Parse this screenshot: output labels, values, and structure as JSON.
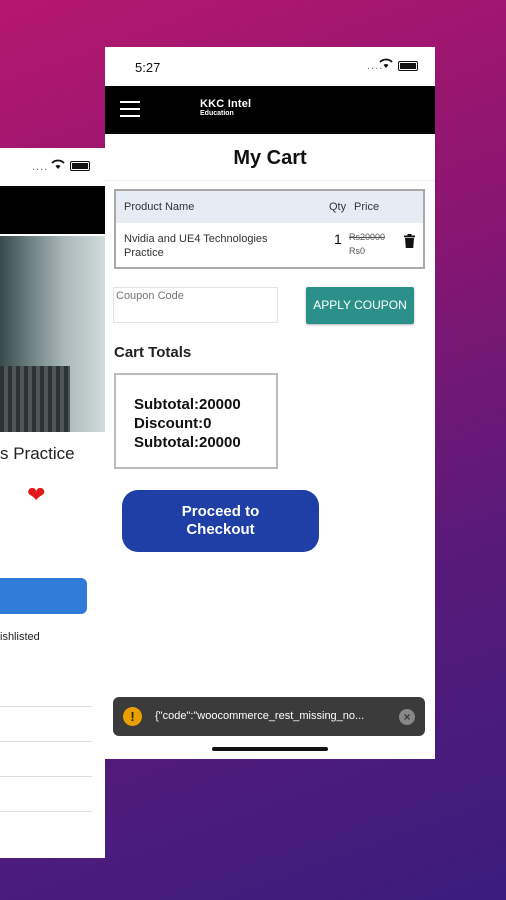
{
  "colors": {
    "accent_teal": "#2b8f8a",
    "checkout_blue": "#1f3fa6",
    "heart_red": "#e01a1a",
    "toast_bg": "#3b3b3b"
  },
  "back_screen": {
    "product_title": "s Practice",
    "wishlist_text": "ishlisted"
  },
  "status_bar": {
    "time": "5:27"
  },
  "app_bar": {
    "logo_line1": "KKC Intel",
    "logo_line2": "Education"
  },
  "page": {
    "title": "My Cart"
  },
  "cart_table": {
    "headers": {
      "product": "Product Name",
      "qty": "Qty",
      "price": "Price"
    },
    "rows": [
      {
        "name": "Nvidia and UE4 Technologies Practice",
        "qty": "1",
        "regular_price": "Rs20000",
        "sale_price": "Rs0"
      }
    ]
  },
  "coupon": {
    "placeholder": "Coupon Code",
    "apply_label": "APPLY COUPON"
  },
  "totals": {
    "heading": "Cart Totals",
    "line1": "Subtotal:20000",
    "line2": "Discount:0",
    "line3": "Subtotal:20000"
  },
  "checkout": {
    "label": "Proceed to Checkout"
  },
  "toast": {
    "message": "{\"code\":\"woocommerce_rest_missing_no...",
    "icon": "!"
  }
}
